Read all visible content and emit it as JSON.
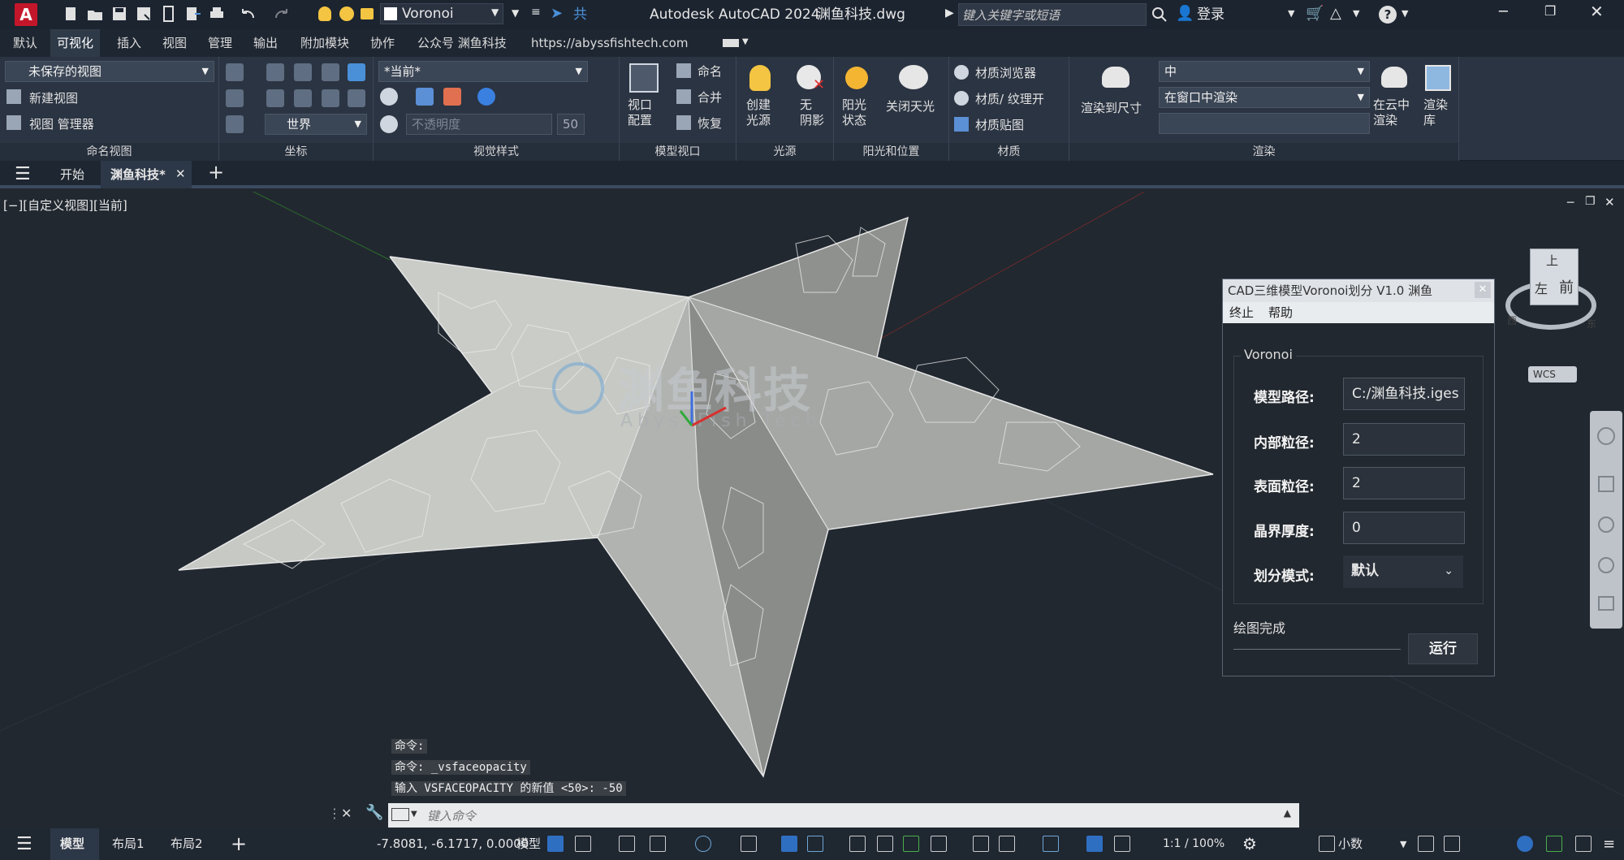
{
  "titlebar": {
    "app_title": "Autodesk AutoCAD 2024",
    "file_name": "渊鱼科技.dwg",
    "workspace": "Voronoi",
    "share_label": "共享",
    "search_placeholder": "键入关键字或短语",
    "login_label": "登录",
    "logo_letter": "A",
    "help_label": "?"
  },
  "menu_tabs": [
    "默认",
    "可视化",
    "插入",
    "视图",
    "管理",
    "输出",
    "附加模块",
    "协作",
    "公众号 渊鱼科技",
    "https://abyssfishtech.com"
  ],
  "active_menu_tab": "可视化",
  "ribbon": {
    "named_views": {
      "title": "命名视图",
      "current": "未保存的视图",
      "new_view": "新建视图",
      "view_manager": "视图 管理器"
    },
    "coordinates": {
      "title": "坐标",
      "ucs": "世界"
    },
    "visual_styles": {
      "title": "视觉样式",
      "current": "*当前*",
      "opacity_placeholder": "不透明度",
      "opacity_value": "50"
    },
    "model_viewports": {
      "title": "模型视口",
      "viewport_config": "视口\n配置",
      "name": "命名",
      "join": "合并",
      "restore": "恢复"
    },
    "lights": {
      "title": "光源",
      "create_light": "创建\n光源",
      "no_shadow": "无\n阴影"
    },
    "sun": {
      "title": "阳光和位置",
      "sun_status": "阳光\n状态",
      "sky_off": "关闭天光"
    },
    "materials": {
      "title": "材质",
      "browser": "材质浏览器",
      "textures": "材质/ 纹理开",
      "mapping": "材质贴图"
    },
    "render": {
      "title": "渲染",
      "render_to_size": "渲染到尺寸",
      "quality": "中",
      "target": "在窗口中渲染",
      "cloud": "在云中\n渲染",
      "library": "渲染\n库"
    }
  },
  "file_tabs": {
    "start": "开始",
    "active": "渊鱼科技*"
  },
  "viewport": {
    "label": "[−][自定义视图][当前]",
    "watermark": "渊鱼科技",
    "watermark_sub": "AbyssFish Tech",
    "viewcube": {
      "top": "上",
      "front": "前",
      "left": "左",
      "s": "南",
      "e": "东",
      "w": "西",
      "wcs": "WCS"
    }
  },
  "dialog": {
    "title": "CAD三维模型Voronoi划分 V1.0 渊鱼",
    "menu": [
      "终止",
      "帮助"
    ],
    "group": "Voronoi",
    "fields": [
      {
        "label": "模型路径:",
        "value": "C:/渊鱼科技.iges"
      },
      {
        "label": "内部粒径:",
        "value": "2"
      },
      {
        "label": "表面粒径:",
        "value": "2"
      },
      {
        "label": "晶界厚度:",
        "value": "0"
      },
      {
        "label": "划分模式:",
        "value": "默认"
      }
    ],
    "status": "绘图完成",
    "run_button": "运行"
  },
  "command": {
    "history": [
      "命令:",
      "命令: _vsfaceopacity",
      "输入 VSFACEOPACITY 的新值 <50>: -50"
    ],
    "placeholder": "键入命令"
  },
  "statusbar": {
    "tabs": [
      "模型",
      "布局1",
      "布局2"
    ],
    "coords": "-7.8081, -6.1717, 0.0000",
    "space": "模型",
    "scale": "1:1 / 100%",
    "units": "小数"
  },
  "colors": {
    "accent": "#4a90d9",
    "logo": "#c4162a",
    "dialog_bg": "#22282f",
    "titlebar": "#1c2430",
    "ribbon": "#2b3442"
  }
}
